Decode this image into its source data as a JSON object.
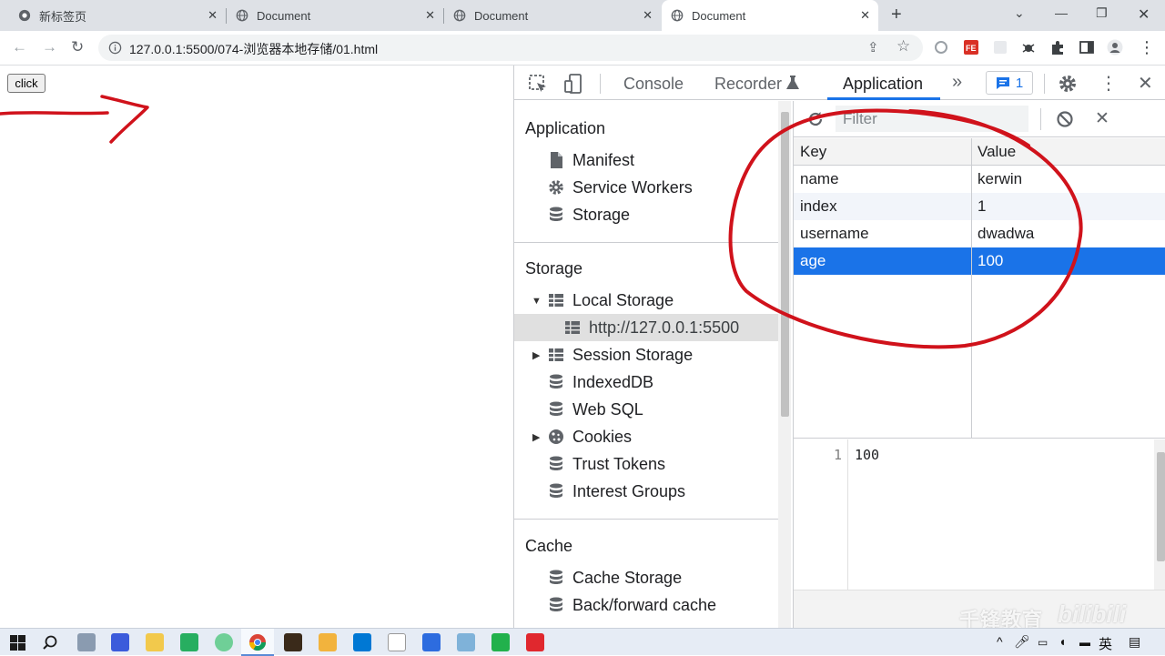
{
  "browser": {
    "tabs": [
      {
        "title": "新标签页",
        "active": false
      },
      {
        "title": "Document",
        "active": false
      },
      {
        "title": "Document",
        "active": false
      },
      {
        "title": "Document",
        "active": true
      }
    ],
    "url": "127.0.0.1:5500/074-浏览器本地存储/01.html"
  },
  "page": {
    "click_button": "click"
  },
  "devtools": {
    "tabs": {
      "console": "Console",
      "recorder": "Recorder",
      "application": "Application",
      "issues_count": "1"
    },
    "sidebar": {
      "application_title": "Application",
      "application_items": [
        {
          "label": "Manifest",
          "icon": "file-icon"
        },
        {
          "label": "Service Workers",
          "icon": "gear-icon"
        },
        {
          "label": "Storage",
          "icon": "database-icon"
        }
      ],
      "storage_title": "Storage",
      "local_storage": "Local Storage",
      "local_storage_origin": "http://127.0.0.1:5500",
      "storage_items": [
        {
          "label": "Session Storage",
          "icon": "table-icon"
        },
        {
          "label": "IndexedDB",
          "icon": "database-icon"
        },
        {
          "label": "Web SQL",
          "icon": "database-icon"
        },
        {
          "label": "Cookies",
          "icon": "cookie-icon"
        },
        {
          "label": "Trust Tokens",
          "icon": "database-icon"
        },
        {
          "label": "Interest Groups",
          "icon": "database-icon"
        }
      ],
      "cache_title": "Cache",
      "cache_items": [
        {
          "label": "Cache Storage",
          "icon": "database-icon"
        },
        {
          "label": "Back/forward cache",
          "icon": "database-icon"
        }
      ]
    },
    "storage_table": {
      "filter_placeholder": "Filter",
      "headers": {
        "key": "Key",
        "value": "Value"
      },
      "rows": [
        {
          "key": "name",
          "value": "kerwin"
        },
        {
          "key": "index",
          "value": "1"
        },
        {
          "key": "username",
          "value": "dwadwa"
        },
        {
          "key": "age",
          "value": "100"
        }
      ],
      "selected_row": 3
    },
    "preview": {
      "line_number": "1",
      "content": "100"
    }
  },
  "watermark": {
    "text": "千锋教育",
    "brand": "bilibili"
  },
  "taskbar": {
    "ime": "英"
  },
  "colors": {
    "accent": "#1a73e8",
    "annotation": "#d0121b"
  }
}
